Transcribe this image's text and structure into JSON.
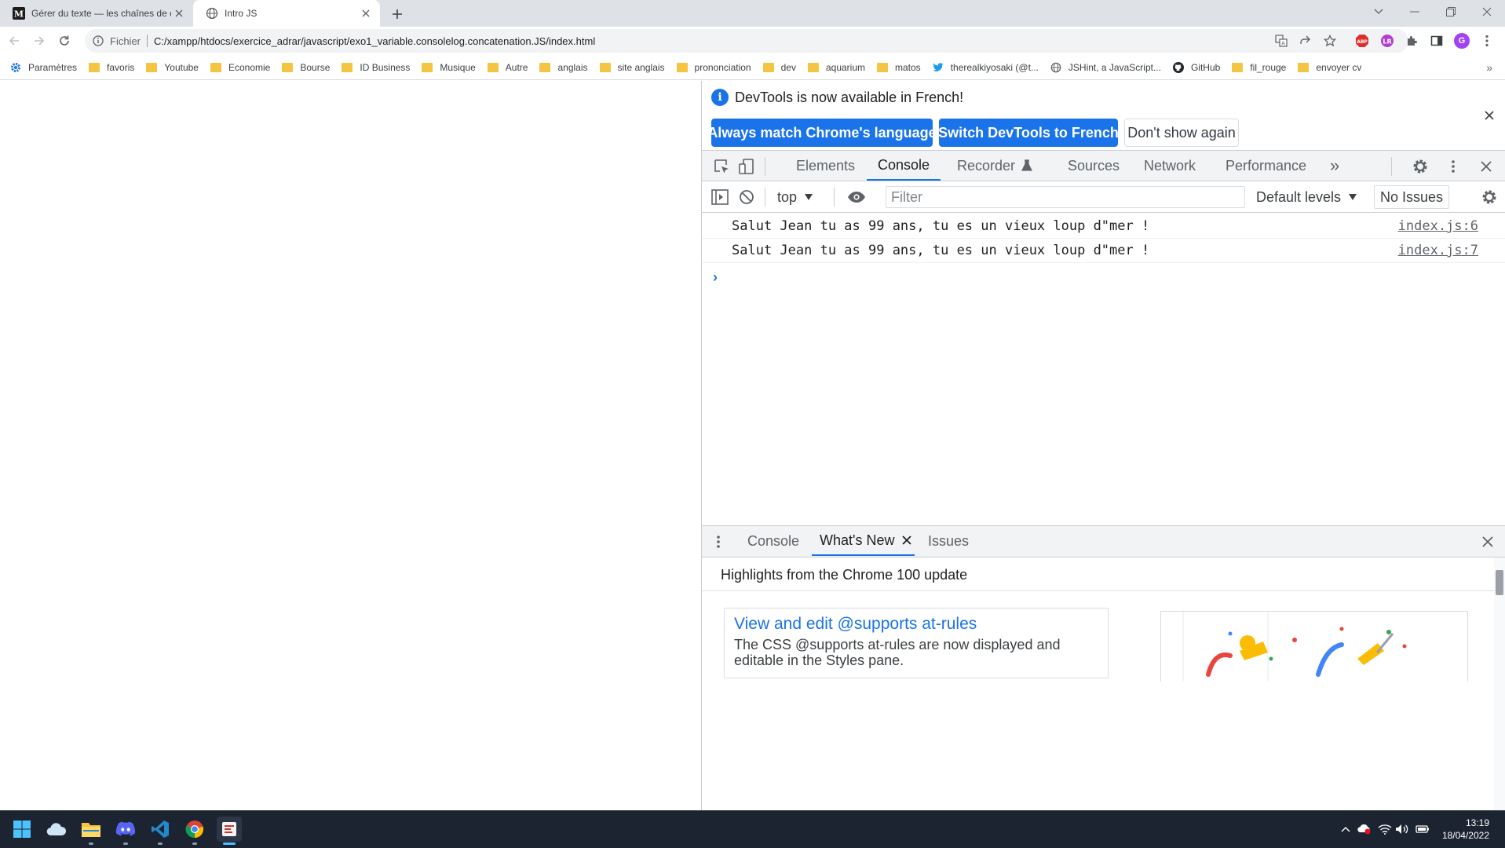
{
  "browser": {
    "tabs": [
      {
        "title": "Gérer du texte — les chaînes de c",
        "favicon": "mdn-icon",
        "active": false
      },
      {
        "title": "Intro JS",
        "favicon": "globe-icon",
        "active": true
      }
    ],
    "omnibox": {
      "scheme_label": "Fichier",
      "url": "C:/xampp/htdocs/exercice_adrar/javascript/exo1_variable.consolelog.concatenation.JS/index.html"
    },
    "profile_initial": "G",
    "bookmarks": [
      {
        "label": "Paramètres",
        "icon": "gear-icon"
      },
      {
        "label": "favoris",
        "icon": "folder-icon"
      },
      {
        "label": "Youtube",
        "icon": "folder-icon"
      },
      {
        "label": "Economie",
        "icon": "folder-icon"
      },
      {
        "label": "Bourse",
        "icon": "folder-icon"
      },
      {
        "label": "ID Business",
        "icon": "folder-icon"
      },
      {
        "label": "Musique",
        "icon": "folder-icon"
      },
      {
        "label": "Autre",
        "icon": "folder-icon"
      },
      {
        "label": "anglais",
        "icon": "folder-icon"
      },
      {
        "label": "site anglais",
        "icon": "folder-icon"
      },
      {
        "label": "prononciation",
        "icon": "folder-icon"
      },
      {
        "label": "dev",
        "icon": "folder-icon"
      },
      {
        "label": "aquarium",
        "icon": "folder-icon"
      },
      {
        "label": "matos",
        "icon": "folder-icon"
      },
      {
        "label": "therealkiyosaki (@t...",
        "icon": "twitter-icon"
      },
      {
        "label": "JSHint, a JavaScript...",
        "icon": "globe-icon"
      },
      {
        "label": "GitHub",
        "icon": "github-icon"
      },
      {
        "label": "fil_rouge",
        "icon": "folder-icon"
      },
      {
        "label": "envoyer cv",
        "icon": "folder-icon"
      }
    ],
    "bookmarks_overflow": "»"
  },
  "devtools": {
    "infobar": {
      "message": "DevTools is now available in French!",
      "btn_match": "Always match Chrome's language",
      "btn_switch": "Switch DevTools to French",
      "btn_dismiss": "Don't show again"
    },
    "tabs": {
      "elements": "Elements",
      "console": "Console",
      "recorder": "Recorder",
      "sources": "Sources",
      "network": "Network",
      "performance": "Performance",
      "more": "»"
    },
    "console_toolbar": {
      "context": "top",
      "filter_placeholder": "Filter",
      "levels": "Default levels",
      "issues": "No Issues"
    },
    "logs": [
      {
        "text": "Salut Jean tu as 99 ans, tu es un vieux loup d\"mer !",
        "source": "index.js:6"
      },
      {
        "text": "Salut Jean tu as 99 ans, tu es un vieux loup d\"mer !",
        "source": "index.js:7"
      }
    ],
    "prompt": "›",
    "drawer": {
      "tabs": {
        "console": "Console",
        "whats_new": "What's New",
        "issues": "Issues"
      },
      "highlights": "Highlights from the Chrome 100 update",
      "card_title": "View and edit @supports at-rules",
      "card_body": "The CSS @supports at-rules are now displayed and editable in the Styles pane."
    }
  },
  "taskbar": {
    "time": "13:19",
    "date": "18/04/2022"
  },
  "colors": {
    "accent": "#1a73e8",
    "taskbar": "#1c2431",
    "tabstrip": "#dee1e6"
  }
}
